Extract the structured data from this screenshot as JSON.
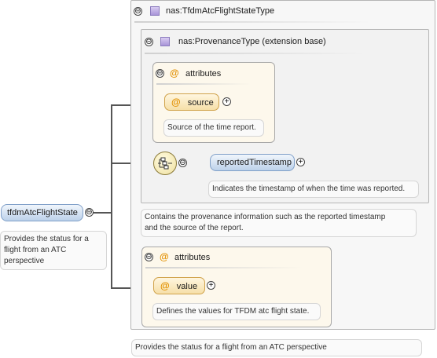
{
  "root_element": {
    "label": "tfdmAtcFlightState",
    "doc": "Provides the status for a flight from an ATC perspective",
    "doc_lines": [
      "Provides the status for a",
      "flight from an ATC",
      "perspective"
    ]
  },
  "complex_type": {
    "label": "nas:TfdmAtcFlightStateType",
    "doc": "Provides the status for a flight from an ATC perspective"
  },
  "base_type": {
    "label": "nas:ProvenanceType (extension base)",
    "doc_lines": [
      "Contains the provenance information such as the reported timestamp",
      "and the source of the report."
    ]
  },
  "base_attributes": {
    "label": "attributes",
    "items": [
      {
        "name": "source",
        "doc": "Source of the time report."
      }
    ]
  },
  "sequence_child": {
    "label": "reportedTimestamp",
    "doc": "Indicates the timestamp of when the time was reported."
  },
  "type_attributes": {
    "label": "attributes",
    "items": [
      {
        "name": "value",
        "doc": "Defines the values for TFDM atc flight state."
      }
    ]
  },
  "symbols": {
    "collapse": "⊖",
    "expand": "+",
    "attribute": "@"
  },
  "colors": {
    "element_pill": "#bcd1ea",
    "attribute_pill": "#f6dfa8",
    "attribute_group_bg": "#fdf8ec",
    "type_icon": "#a995d8"
  }
}
